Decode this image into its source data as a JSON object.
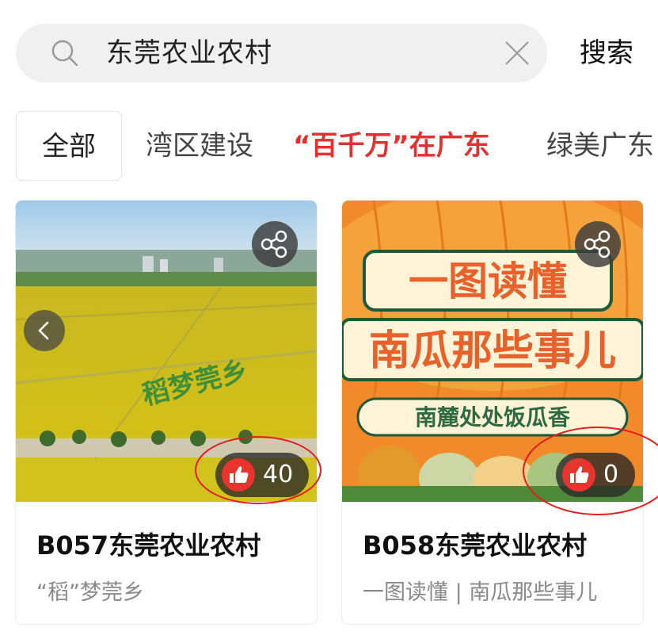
{
  "search": {
    "query": "东莞农业农村",
    "button_label": "搜索"
  },
  "tabs": [
    {
      "label": "全部"
    },
    {
      "label": "湾区建设"
    },
    {
      "label": "“百千万”在广东"
    },
    {
      "label": "绿美广东"
    }
  ],
  "cards": [
    {
      "title": "B057东莞农业农村",
      "subtitle": "“稻”梦莞乡",
      "likes": "40",
      "image_text": "稻梦莞乡"
    },
    {
      "title": "B058东莞农业农村",
      "subtitle": "一图读懂 | 南瓜那些事儿",
      "likes": "0",
      "image_text": {
        "line1": "一图读懂",
        "line2": "南瓜那些事儿",
        "line3": "南麓处处饭瓜香"
      }
    }
  ],
  "colors": {
    "accent_red": "#e62f2f",
    "like_red": "#e8332f",
    "annotation_red": "#e31b1b",
    "search_bg": "#f0f0f0"
  }
}
